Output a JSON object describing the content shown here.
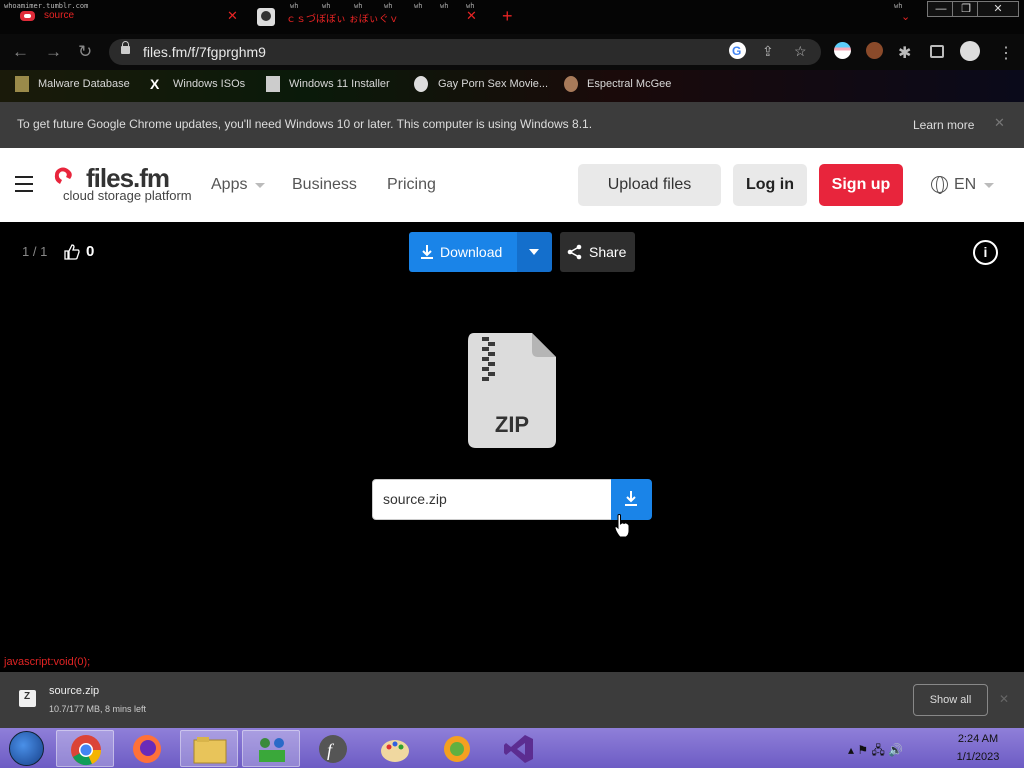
{
  "browser": {
    "tabs": [
      {
        "tiny": "whoamimer.tumblr.com",
        "title": "source"
      },
      {
        "tiny": "",
        "title": "ｃｓづぼぼぃ ぉぼぃぐｖ"
      }
    ],
    "tab_tiny_texts": [
      "wh",
      "wh",
      "wh",
      "wh",
      "wh",
      "wh",
      "wh",
      "wh"
    ],
    "url": "files.fm/f/7fgprghm9",
    "bookmarks": [
      "Malware Database",
      "Windows ISOs",
      "Windows 11 Installer",
      "Gay Porn Sex Movie...",
      "Espectral McGee"
    ],
    "infobar": {
      "text": "To get future Google Chrome updates, you'll need Windows 10 or later. This computer is using Windows 8.1.",
      "learn_more": "Learn more"
    },
    "status_url": "javascript:void(0);"
  },
  "site": {
    "logo_text": "files.fm",
    "logo_sub": "cloud storage platform",
    "nav": [
      "Apps",
      "Business",
      "Pricing"
    ],
    "upload_label": "Upload files",
    "login_label": "Log in",
    "signup_label": "Sign up",
    "language": "EN",
    "brand_color": "#e8253c",
    "accent_color": "#1a84e8"
  },
  "file": {
    "pager": "1 / 1",
    "likes": "0",
    "download_label": "Download",
    "share_label": "Share",
    "type_label": "ZIP",
    "name": "source.zip"
  },
  "download_shelf": {
    "filename": "source.zip",
    "status": "10.7/177 MB, 8 mins left",
    "show_all": "Show all"
  },
  "taskbar": {
    "time": "2:24 AM",
    "date": "1/1/2023"
  }
}
